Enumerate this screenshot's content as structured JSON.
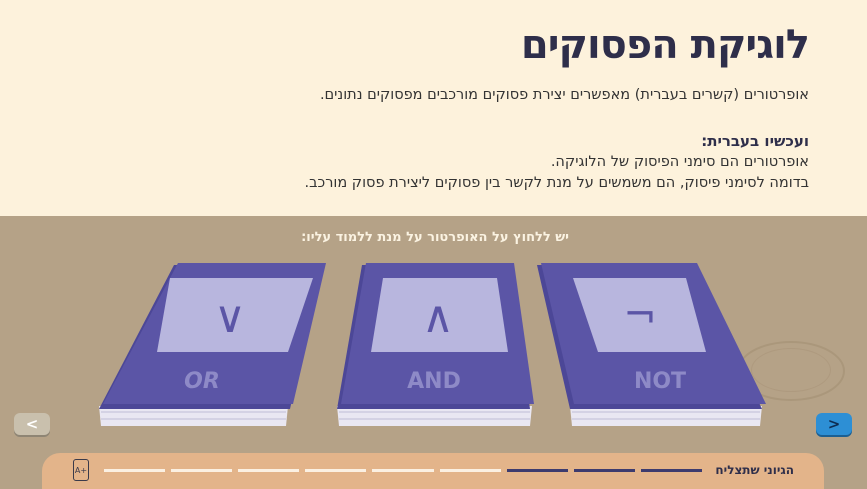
{
  "header": {
    "title": "לוגיקת הפסוקים",
    "intro": "אופרטורים (קשרים בעברית) מאפשרים יצירת פסוקים מורכבים מפסוקים נתונים.",
    "subheading": "ועכשיו בעברית:",
    "body_line_1": "אופרטורים הם סימני הפיסוק של הלוגיקה.",
    "body_line_2": "בדומה לסימני פיסוק, הם משמשים על מנת לקשר בין פסוקים ליצירת פסוק מורכב."
  },
  "instruction": "יש ללחוץ על האופרטור על מנת ללמוד עליו:",
  "books": [
    {
      "label": "OR",
      "symbol": "∨",
      "symbol_name": "logical-or-symbol"
    },
    {
      "label": "AND",
      "symbol": "∧",
      "symbol_name": "logical-and-symbol"
    },
    {
      "label": "NOT",
      "symbol": "¬",
      "symbol_name": "logical-not-symbol"
    }
  ],
  "colors": {
    "book_cover": "#5b55a6",
    "book_window": "#b8b6de",
    "page_background": "#fdf2dc",
    "desk": "#b5a287",
    "progress_bar": "#e3b48a",
    "progress_done": "#3d3b6e",
    "next_button": "#2d8fd5"
  },
  "nav": {
    "prev_label": "<",
    "next_label": ">"
  },
  "progress": {
    "label": "הגיוני שתצליח",
    "text_size_icon": "text-size-icon",
    "text_size_label": "A+",
    "total_segments": 9,
    "completed_segments": 3
  }
}
